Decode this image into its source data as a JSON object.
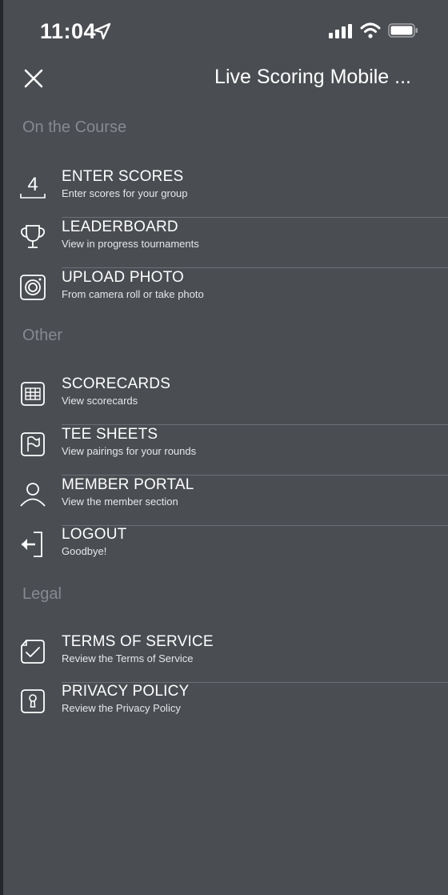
{
  "status_bar": {
    "time": "11:04"
  },
  "header": {
    "title": "Live Scoring Mobile ...",
    "close_icon": "close-icon"
  },
  "sections": {
    "on_the_course": {
      "title": "On the Course",
      "items": [
        {
          "label": "ENTER SCORES",
          "sub": "Enter scores for your group",
          "icon": "score-four-icon",
          "icon_text": "4"
        },
        {
          "label": "LEADERBOARD",
          "sub": "View in progress tournaments",
          "icon": "trophy-icon"
        },
        {
          "label": "UPLOAD PHOTO",
          "sub": "From camera roll or take photo",
          "icon": "camera-icon"
        }
      ]
    },
    "other": {
      "title": "Other",
      "items": [
        {
          "label": "SCORECARDS",
          "sub": "View scorecards",
          "icon": "grid-icon"
        },
        {
          "label": "TEE SHEETS",
          "sub": "View pairings for your rounds",
          "icon": "flag-icon"
        },
        {
          "label": "MEMBER PORTAL",
          "sub": "View the member section",
          "icon": "person-icon"
        },
        {
          "label": "LOGOUT",
          "sub": "Goodbye!",
          "icon": "logout-icon"
        }
      ]
    },
    "legal": {
      "title": "Legal",
      "items": [
        {
          "label": "TERMS OF SERVICE",
          "sub": "Review the Terms of Service",
          "icon": "checkmark-icon"
        },
        {
          "label": "PRIVACY POLICY",
          "sub": "Review the Privacy Policy",
          "icon": "keyhole-icon"
        }
      ]
    }
  },
  "colors": {
    "background": "#4a4d52",
    "section_title": "#868a90",
    "divider": "#6c7076",
    "text": "#ffffff"
  }
}
